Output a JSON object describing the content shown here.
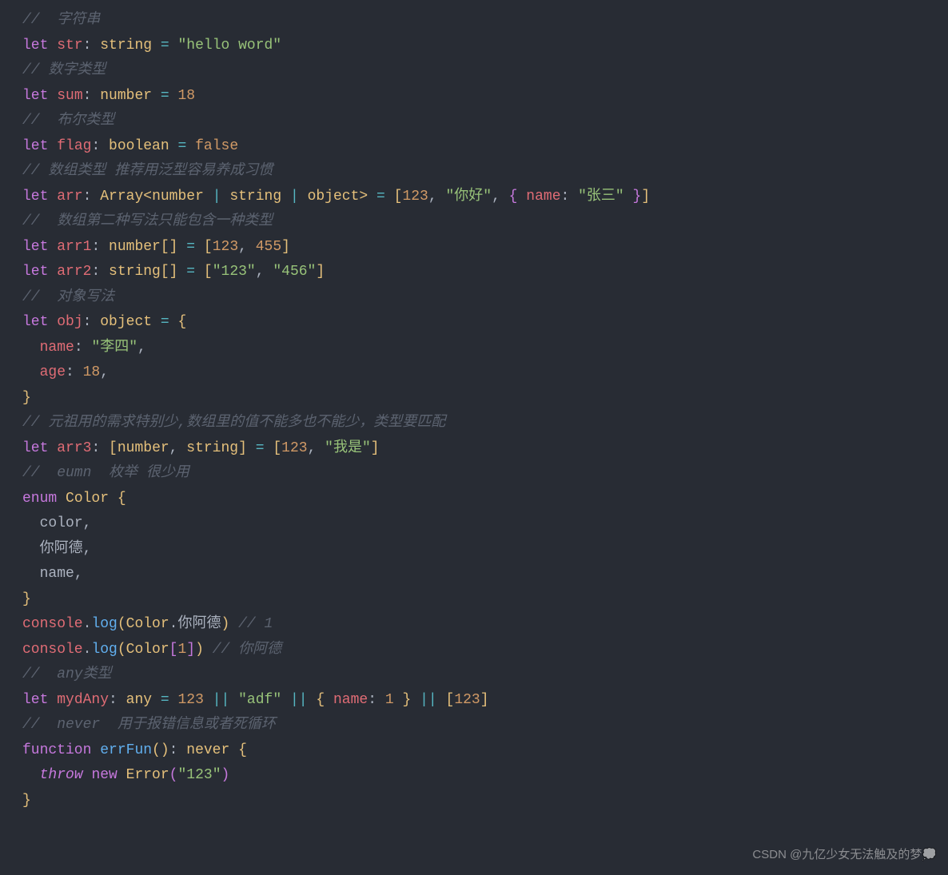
{
  "lines": {
    "c1": "//  字符串",
    "l1_let": "let",
    "l1_v": "str",
    "l1_t": "string",
    "l1_s": "\"hello word\"",
    "c2": "// 数字类型",
    "l2_let": "let",
    "l2_v": "sum",
    "l2_t": "number",
    "l2_n": "18",
    "c3": "//  布尔类型",
    "l3_let": "let",
    "l3_v": "flag",
    "l3_t": "boolean",
    "l3_b": "false",
    "c4": "// 数组类型 推荐用泛型容易养成习惯",
    "l4_let": "let",
    "l4_v": "arr",
    "l4_t1": "Array",
    "l4_t2": "number",
    "l4_t3": "string",
    "l4_t4": "object",
    "l4_n": "123",
    "l4_s1": "\"你好\"",
    "l4_p": "name",
    "l4_s2": "\"张三\"",
    "c5": "//  数组第二种写法只能包含一种类型",
    "l5_let": "let",
    "l5_v": "arr1",
    "l5_t": "number",
    "l5_n1": "123",
    "l5_n2": "455",
    "l6_let": "let",
    "l6_v": "arr2",
    "l6_t": "string",
    "l6_s1": "\"123\"",
    "l6_s2": "\"456\"",
    "c6": "//  对象写法",
    "l7_let": "let",
    "l7_v": "obj",
    "l7_t": "object",
    "l7_p1": "name",
    "l7_s1": "\"李四\"",
    "l7_p2": "age",
    "l7_n2": "18",
    "c7": "// 元祖用的需求特别少,数组里的值不能多也不能少，类型要匹配",
    "l8_let": "let",
    "l8_v": "arr3",
    "l8_t1": "number",
    "l8_t2": "string",
    "l8_n": "123",
    "l8_s": "\"我是\"",
    "c8": "//  eumn  枚举 很少用",
    "l9_kw": "enum",
    "l9_v": "Color",
    "l9_m1": "color",
    "l9_m2": "你阿德",
    "l9_m3": "name",
    "l10_o": "console",
    "l10_f": "log",
    "l10_c": "Color",
    "l10_p": "你阿德",
    "l10_cm": "// 1",
    "l11_o": "console",
    "l11_f": "log",
    "l11_c": "Color",
    "l11_n": "1",
    "l11_cm": "// 你阿德",
    "c9": "//  any类型",
    "l12_let": "let",
    "l12_v": "mydAny",
    "l12_t": "any",
    "l12_n1": "123",
    "l12_s": "\"adf\"",
    "l12_p": "name",
    "l12_n2": "1",
    "l12_n3": "123",
    "c10": "//  never  用于报错信息或者死循环",
    "l13_kw": "function",
    "l13_v": "errFun",
    "l13_t": "never",
    "l13_th": "throw",
    "l13_nw": "new",
    "l13_e": "Error",
    "l13_s": "\"123\""
  },
  "watermark": "CSDN @九亿少女无法触及的梦💭"
}
